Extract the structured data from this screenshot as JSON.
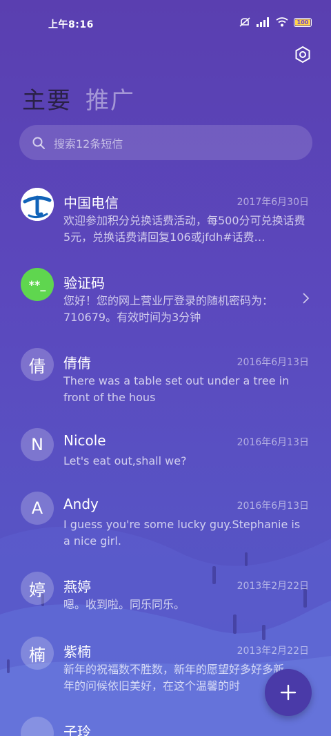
{
  "status": {
    "time": "上午8:16",
    "battery": "100"
  },
  "tabs": [
    {
      "label": "主要"
    },
    {
      "label": "推广"
    }
  ],
  "search": {
    "placeholder": "搜索12条短信"
  },
  "messages": [
    {
      "name": "中国电信",
      "date": "2017年6月30日",
      "preview": "欢迎参加积分兑换话费活动，每500分可兑换话费5元，兑换话费请回复106或jfdh#话费…",
      "avatar": "china-telecom-logo"
    },
    {
      "name": "验证码",
      "date": "",
      "preview": "您好！您的网上营业厅登录的随机密码为：710679。有效时间为3分钟",
      "avatar_text": "**_"
    },
    {
      "name": "倩倩",
      "date": "2016年6月13日",
      "preview": "There was a table set out under a tree in front of the hous",
      "avatar_text": "倩"
    },
    {
      "name": "Nicole",
      "date": "2016年6月13日",
      "preview": "Let's eat out,shall we?",
      "avatar_text": "N"
    },
    {
      "name": "Andy",
      "date": "2016年6月13日",
      "preview": "I guess you're some lucky guy.Stephanie is a nice girl.",
      "avatar_text": "A"
    },
    {
      "name": "燕婷",
      "date": "2013年2月22日",
      "preview": "嗯。收到啦。同乐同乐。",
      "avatar_text": "婷"
    },
    {
      "name": "紫楠",
      "date": "2013年2月22日",
      "preview": "新年的祝福数不胜数，新年的愿望好多好多新年的问候依旧美好，在这个温馨的时",
      "avatar_text": "楠"
    },
    {
      "name": "子玲",
      "date": "",
      "preview": "",
      "avatar_text": ""
    }
  ],
  "colors": {
    "verify_avatar": "#5fd64f",
    "active_tab": "#2a2147",
    "fab": "#4a3aa8"
  },
  "icons": {
    "settings": "settings-icon",
    "search": "search-icon",
    "compose": "plus-icon",
    "chevron": "chevron-right-icon"
  }
}
